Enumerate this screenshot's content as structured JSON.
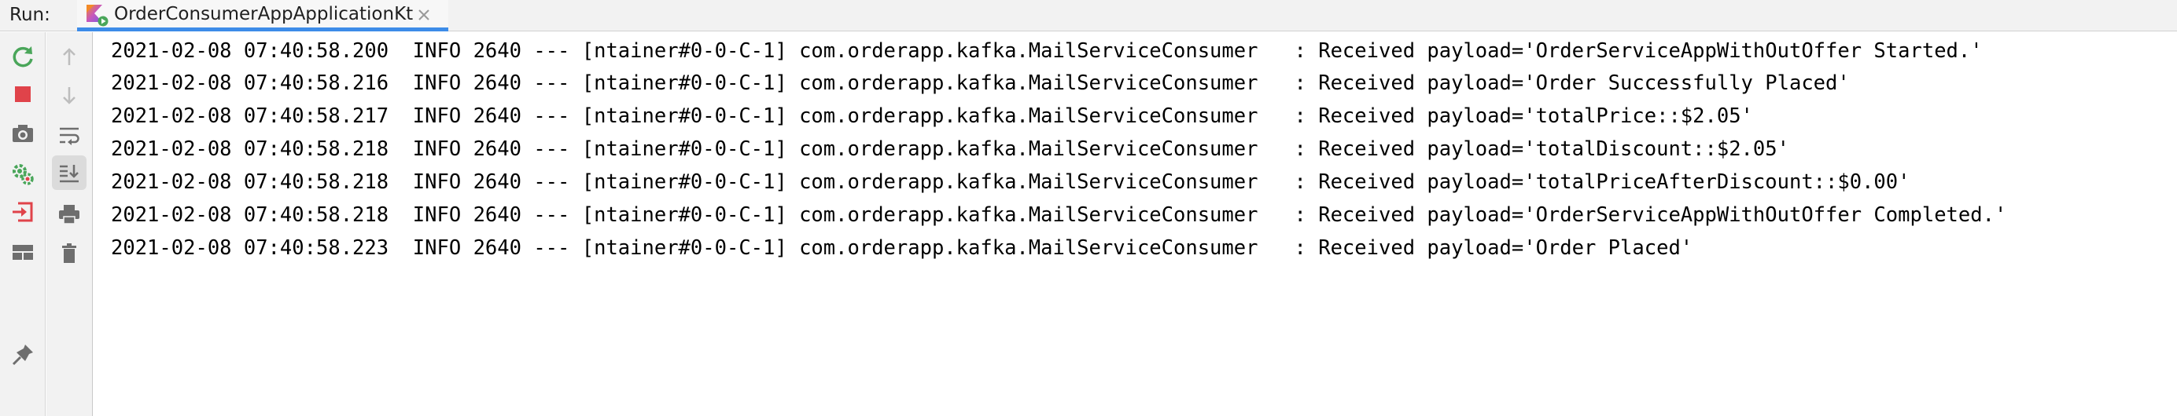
{
  "run_bar": {
    "label": "Run:",
    "tab": {
      "title": "OrderConsumerAppApplicationKt",
      "icon": "kotlin-run-config-icon"
    }
  },
  "toolbar_outer": [
    {
      "name": "rerun-icon",
      "tooltip": "Rerun"
    },
    {
      "name": "stop-icon",
      "tooltip": "Stop"
    },
    {
      "name": "camera-icon",
      "tooltip": "Dump Threads"
    },
    {
      "name": "debug-gear-icon",
      "tooltip": "Settings"
    },
    {
      "name": "exit-icon",
      "tooltip": "Exit"
    },
    {
      "name": "layout-icon",
      "tooltip": "Layout"
    },
    {
      "name": "pin-icon",
      "tooltip": "Pin Tab"
    }
  ],
  "toolbar_inner": [
    {
      "name": "arrow-up-icon"
    },
    {
      "name": "arrow-down-icon"
    },
    {
      "name": "soft-wrap-icon"
    },
    {
      "name": "scroll-to-end-icon"
    },
    {
      "name": "print-icon"
    },
    {
      "name": "trash-icon"
    }
  ],
  "console": {
    "lines": [
      "2021-02-08 07:40:58.200  INFO 2640 --- [ntainer#0-0-C-1] com.orderapp.kafka.MailServiceConsumer   : Received payload='OrderServiceAppWithOutOffer Started.'",
      "2021-02-08 07:40:58.216  INFO 2640 --- [ntainer#0-0-C-1] com.orderapp.kafka.MailServiceConsumer   : Received payload='Order Successfully Placed'",
      "2021-02-08 07:40:58.217  INFO 2640 --- [ntainer#0-0-C-1] com.orderapp.kafka.MailServiceConsumer   : Received payload='totalPrice::$2.05'",
      "2021-02-08 07:40:58.218  INFO 2640 --- [ntainer#0-0-C-1] com.orderapp.kafka.MailServiceConsumer   : Received payload='totalDiscount::$2.05'",
      "2021-02-08 07:40:58.218  INFO 2640 --- [ntainer#0-0-C-1] com.orderapp.kafka.MailServiceConsumer   : Received payload='totalPriceAfterDiscount::$0.00'",
      "2021-02-08 07:40:58.218  INFO 2640 --- [ntainer#0-0-C-1] com.orderapp.kafka.MailServiceConsumer   : Received payload='OrderServiceAppWithOutOffer Completed.'",
      "2021-02-08 07:40:58.223  INFO 2640 --- [ntainer#0-0-C-1] com.orderapp.kafka.MailServiceConsumer   : Received payload='Order Placed'"
    ]
  },
  "colors": {
    "accent_tab": "#3d8ce8",
    "rerun_green": "#4aa65a",
    "stop_red": "#e0434a",
    "kotlin_orange": "#f28a28",
    "kotlin_purple": "#7b5be0",
    "icon_gray": "#6e6e6e",
    "icon_disabled": "#bdbdbd"
  }
}
